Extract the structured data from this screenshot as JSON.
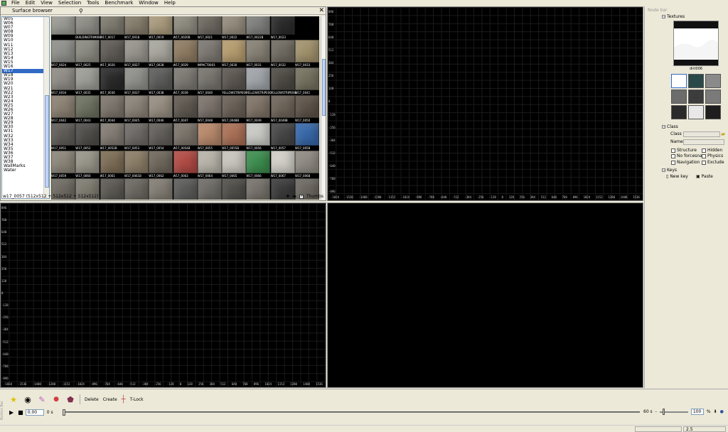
{
  "menu": [
    "File",
    "Edit",
    "View",
    "Selection",
    "Tools",
    "Benchmark",
    "Window",
    "Help"
  ],
  "surface_browser": {
    "title": "Surface browser",
    "list": [
      "W05",
      "W06",
      "W07",
      "W08",
      "W09",
      "W10",
      "W11",
      "W12",
      "W13",
      "W14",
      "W15",
      "W16",
      "W17",
      "W18",
      "W19",
      "W20",
      "W21",
      "W22",
      "W23",
      "W24",
      "W25",
      "W26",
      "W27",
      "W28",
      "W29",
      "W30",
      "W31",
      "W32",
      "W33",
      "W34",
      "W35",
      "W36",
      "W37",
      "W38",
      "WallMarks",
      "Water"
    ],
    "selected": "W17",
    "rows": [
      {
        "tiles": [
          {
            "name": "",
            "color": "#9a9a94"
          },
          {
            "name": "BUILDINGTRIM0001",
            "color": "#8f8d86"
          },
          {
            "name": "W17_0017",
            "color": "#7d7a6f"
          },
          {
            "name": "W17_0018",
            "color": "#857c6c"
          },
          {
            "name": "W17_0019",
            "color": "#a89a7c"
          },
          {
            "name": "W17_0020B",
            "color": "#8e8b80"
          },
          {
            "name": "W17_0021",
            "color": "#6d6860"
          },
          {
            "name": "W17_0022",
            "color": "#938b7c"
          },
          {
            "name": "W17_0022B",
            "color": "#7f7f7d"
          },
          {
            "name": "W17_0023",
            "color": "#2b2b2b"
          }
        ]
      },
      {
        "tiles": [
          {
            "name": "W17_0024",
            "color": "#8e8e8a"
          },
          {
            "name": "W17_0025",
            "color": "#8a8980"
          },
          {
            "name": "W17_0026",
            "color": "#5e5a54"
          },
          {
            "name": "W17_0027",
            "color": "#96938c"
          },
          {
            "name": "W17_0028",
            "color": "#a7a59c"
          },
          {
            "name": "W17_0029",
            "color": "#8d7a61"
          },
          {
            "name": "IMPACT0001",
            "color": "#7b7670"
          },
          {
            "name": "W17_0030",
            "color": "#b49b6e"
          },
          {
            "name": "W17_0031",
            "color": "#857f73"
          },
          {
            "name": "W17_0032",
            "color": "#6f6a61"
          },
          {
            "name": "W17_0033",
            "color": "#a0916c"
          }
        ]
      },
      {
        "tiles": [
          {
            "name": "W17_0034",
            "color": "#8e8b85"
          },
          {
            "name": "W17_0035",
            "color": "#9c9c96"
          },
          {
            "name": "W17_0036",
            "color": "#2a2a2a"
          },
          {
            "name": "W17_0037",
            "color": "#8f8f8a"
          },
          {
            "name": "W17_0038",
            "color": "#5c5c5a"
          },
          {
            "name": "W17_0039",
            "color": "#7b7872"
          },
          {
            "name": "W17_0040",
            "color": "#76736d"
          },
          {
            "name": "YELLOWSTRIPE0001",
            "color": "#5b5650"
          },
          {
            "name": "YELLOWSTRIPE0002",
            "color": "#9fa3a8"
          },
          {
            "name": "YELLOWSTRIPE0003",
            "color": "#4d4a44"
          },
          {
            "name": "W17_0041",
            "color": "#73705e"
          }
        ]
      },
      {
        "tiles": [
          {
            "name": "W17_0042",
            "color": "#8a7f72"
          },
          {
            "name": "W17_0043",
            "color": "#6c705e"
          },
          {
            "name": "W17_0044",
            "color": "#7b746b"
          },
          {
            "name": "W17_0045",
            "color": "#8a8277"
          },
          {
            "name": "W17_0046",
            "color": "#958c7f"
          },
          {
            "name": "W17_0047",
            "color": "#5e5850"
          },
          {
            "name": "W17_0048",
            "color": "#7a716a"
          },
          {
            "name": "W17_0048B",
            "color": "#685f56"
          },
          {
            "name": "W17_0049",
            "color": "#7e7266"
          },
          {
            "name": "W17_0049B",
            "color": "#6d6459"
          },
          {
            "name": "W17_0050",
            "color": "#5c5248"
          }
        ]
      },
      {
        "tiles": [
          {
            "name": "W17_0051",
            "color": "#5f5c58"
          },
          {
            "name": "W17_0052",
            "color": "#4e4d4a"
          },
          {
            "name": "W17_0052B",
            "color": "#807a72"
          },
          {
            "name": "W17_0053",
            "color": "#6d6965"
          },
          {
            "name": "W17_0054",
            "color": "#615e59"
          },
          {
            "name": "W17_0054B",
            "color": "#7a736a"
          },
          {
            "name": "W17_0055",
            "color": "#b5876a"
          },
          {
            "name": "W17_0055B",
            "color": "#a86f55"
          },
          {
            "name": "W17_0056",
            "color": "#c8c8c4"
          },
          {
            "name": "W17_0057",
            "color": "#454545"
          },
          {
            "name": "W17_0058",
            "color": "#3767a8"
          }
        ]
      },
      {
        "tiles": [
          {
            "name": "W17_0059",
            "color": "#8b8579"
          },
          {
            "name": "W17_0060",
            "color": "#979488"
          },
          {
            "name": "W17_0061",
            "color": "#7b6c55"
          },
          {
            "name": "W17_0061B",
            "color": "#8a7c66"
          },
          {
            "name": "W17_0062",
            "color": "#6e665b"
          },
          {
            "name": "W17_0063",
            "color": "#b04a44"
          },
          {
            "name": "W17_0064",
            "color": "#b6b2a8"
          },
          {
            "name": "W17_0065",
            "color": "#c7c4bc"
          },
          {
            "name": "W17_0066",
            "color": "#3c8c4e"
          },
          {
            "name": "W17_0067",
            "color": "#d0cec6"
          },
          {
            "name": "W17_0068",
            "color": "#8e8a82"
          }
        ]
      },
      {
        "tiles": [
          {
            "name": "",
            "color": "#6e6a62"
          },
          {
            "name": "",
            "color": "#7d7a70"
          },
          {
            "name": "",
            "color": "#5b5852"
          },
          {
            "name": "",
            "color": "#6a6660"
          },
          {
            "name": "",
            "color": "#807b72"
          },
          {
            "name": "",
            "color": "#5a5a58"
          },
          {
            "name": "",
            "color": "#6e6b66"
          },
          {
            "name": "",
            "color": "#4f4d48"
          },
          {
            "name": "",
            "color": "#75716a"
          },
          {
            "name": "",
            "color": "#3a3a3a"
          },
          {
            "name": "",
            "color": "#6b6760"
          }
        ]
      }
    ],
    "status": "w17_0057 (512x512 + 512x512 + 512x512)",
    "thumbs_label": "Thumbs"
  },
  "viewports": {
    "top_right": {
      "x_ticks": [
        "-1024",
        "-1536",
        "-1408",
        "-1280",
        "-1152",
        "-1024",
        "-896",
        "-768",
        "-640",
        "-512",
        "-384",
        "-256",
        "-128",
        "0",
        "128",
        "256",
        "384",
        "512",
        "640",
        "768",
        "896",
        "1024",
        "1152",
        "1280",
        "1408",
        "1536"
      ],
      "y_ticks": [
        "896",
        "768",
        "640",
        "512",
        "384",
        "256",
        "128",
        "0",
        "-128",
        "-256",
        "-384",
        "-512",
        "-640",
        "-768",
        "-896"
      ]
    },
    "bottom_left": {
      "x_ticks": [
        "-1664",
        "-1536",
        "-1408",
        "-1280",
        "-1152",
        "-1024",
        "-896",
        "-768",
        "-640",
        "-512",
        "-384",
        "-256",
        "-128",
        "0",
        "128",
        "256",
        "384",
        "512",
        "640",
        "768",
        "896",
        "1024",
        "1152",
        "1280",
        "1408",
        "1536"
      ],
      "y_ticks": [
        "896",
        "768",
        "640",
        "512",
        "384",
        "256",
        "128",
        "0",
        "-128",
        "-256",
        "-384",
        "-512",
        "-640",
        "-768",
        "-896"
      ]
    }
  },
  "node_bar": {
    "title": "Node bar",
    "textures_label": "Textures",
    "texture_name": "dirt006",
    "class_section": "Class",
    "class_label": "Class",
    "name_label": "Name",
    "checks": [
      "Structure",
      "Hidden",
      "No forcesnap",
      "Physics",
      "Navigation",
      "Exclude"
    ],
    "keys_section": "Keys",
    "new_key": "New key",
    "paste": "Paste"
  },
  "button_bar": {
    "side_label": "Button Bar",
    "delete": "Delete",
    "create": "Create",
    "tlock": "T-Lock",
    "time_value": "0.00",
    "start_label": "0 s",
    "end_label": "60 s",
    "zoom_value": "100",
    "zoom_unit": "%"
  },
  "statusbar": {
    "value": "2.5"
  }
}
